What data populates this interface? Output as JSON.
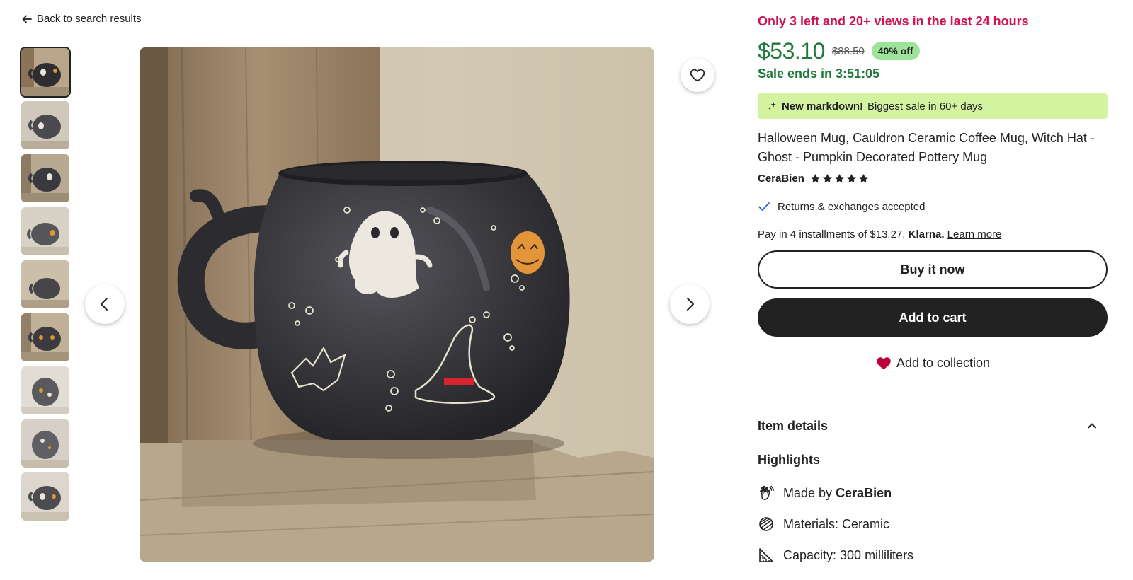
{
  "nav": {
    "back_label": "Back to search results"
  },
  "gallery": {
    "thumbnail_count": 9,
    "active_index": 0
  },
  "listing": {
    "scarcity": "Only 3 left and 20+ views in the last 24 hours",
    "price": "$53.10",
    "original_price": "$88.50",
    "discount": "40% off",
    "sale_ends": "Sale ends in 3:51:05",
    "markdown_strong": "New markdown!",
    "markdown_text": "Biggest sale in 60+ days",
    "title": "Halloween Mug, Cauldron Ceramic Coffee Mug, Witch Hat - Ghost - Pumpkin Decorated Pottery Mug",
    "seller": "CeraBien",
    "rating_stars": 5,
    "returns": "Returns & exchanges accepted",
    "installments_text": "Pay in 4 installments of $13.27.",
    "klarna": "Klarna.",
    "learn_more": "Learn more"
  },
  "actions": {
    "buy_now": "Buy it now",
    "add_to_cart": "Add to cart",
    "add_to_collection": "Add to collection"
  },
  "details": {
    "header": "Item details",
    "highlights_title": "Highlights",
    "made_by_prefix": "Made by",
    "made_by_seller": "CeraBien",
    "materials": "Materials: Ceramic",
    "capacity": "Capacity: 300 milliliters"
  },
  "colors": {
    "scarcity": "#d1134f",
    "price": "#1d7a3a",
    "discount_badge": "#9ee39a",
    "markdown_banner": "#d4f3a1",
    "collection_heart": "#b8003b"
  },
  "icons": {
    "back": "arrow-left-icon",
    "prev": "chevron-left-icon",
    "next": "chevron-right-icon",
    "favorite": "heart-outline-icon",
    "markdown": "sparkle-icon",
    "returns": "checkmark-icon",
    "collection": "heart-filled-icon",
    "details_toggle": "chevron-up-icon",
    "made_by": "hand-icon",
    "materials": "material-icon",
    "capacity": "ruler-icon"
  }
}
